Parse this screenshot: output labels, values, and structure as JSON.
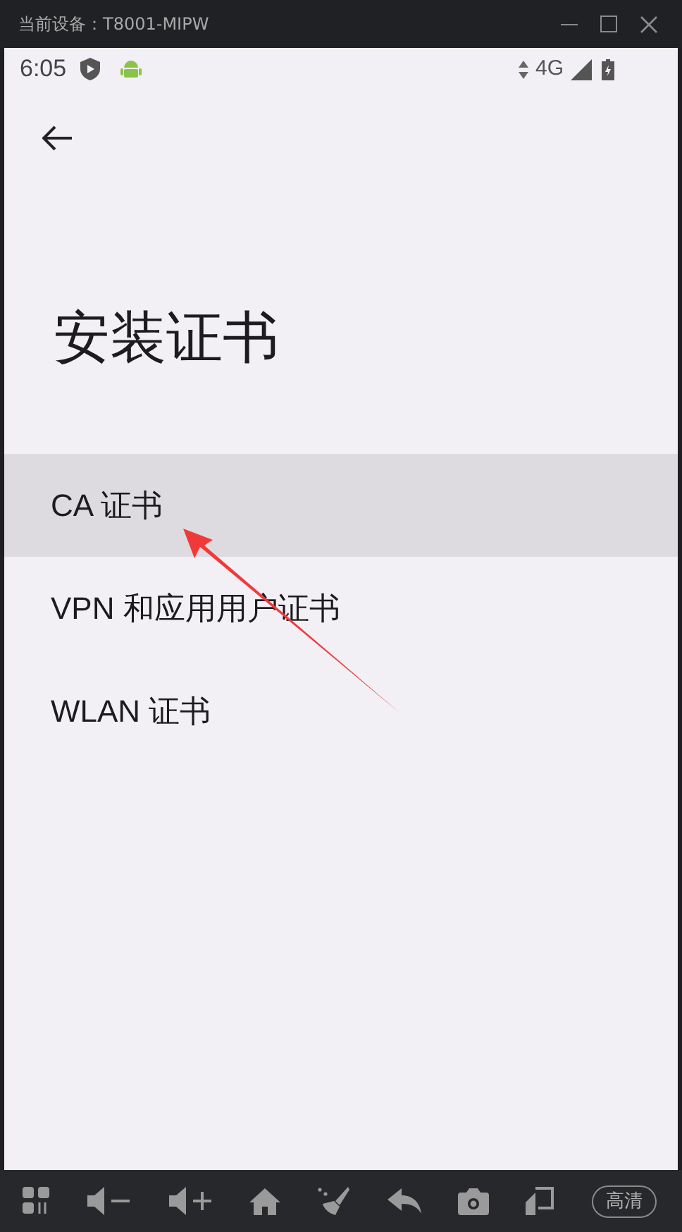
{
  "window": {
    "title": "当前设备：T8001-MIPW"
  },
  "status_bar": {
    "time": "6:05",
    "network": "4G"
  },
  "page": {
    "title": "安装证书"
  },
  "items": [
    {
      "label": "CA 证书",
      "selected": true
    },
    {
      "label": "VPN 和应用用户证书",
      "selected": false
    },
    {
      "label": "WLAN 证书",
      "selected": false
    }
  ],
  "toolbar": {
    "quality_button": "高清"
  }
}
